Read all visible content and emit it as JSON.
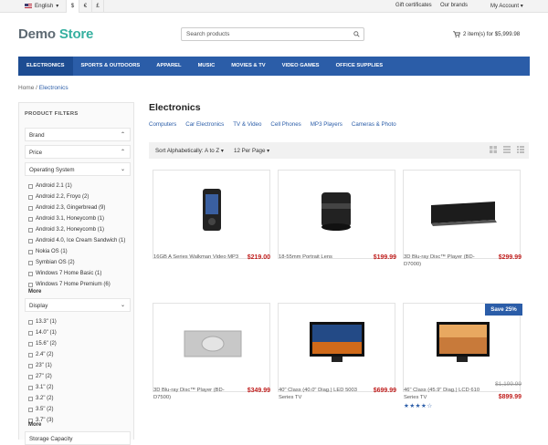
{
  "topbar": {
    "language": "English",
    "currencies": [
      "$",
      "€",
      "£"
    ],
    "links": [
      "Gift certificates",
      "Our brands"
    ],
    "account": "My Account"
  },
  "header": {
    "logo_part1": "Demo",
    "logo_part2": "Store",
    "search_placeholder": "Search products",
    "cart": "2 item(s) for $5,999.98"
  },
  "nav": [
    "ELECTRONICS",
    "SPORTS & OUTDOORS",
    "APPAREL",
    "MUSIC",
    "MOVIES & TV",
    "VIDEO GAMES",
    "OFFICE SUPPLIES"
  ],
  "breadcrumb": {
    "home": "Home",
    "sep": "/",
    "current": "Electronics"
  },
  "filters": {
    "heading": "PRODUCT FILTERS",
    "groups": [
      "Brand",
      "Price",
      "Operating System",
      "Display",
      "Storage Capacity"
    ],
    "os_options": [
      "Android 2.1 (1)",
      "Android 2.2, Froyo (2)",
      "Android 2.3, Gingerbread (9)",
      "Android 3.1, Honeycomb (1)",
      "Android 3.2, Honeycomb (1)",
      "Android 4.0, Ice Cream Sandwich (1)",
      "Nokia OS (1)",
      "Symbian OS (2)",
      "Windows 7 Home Basic (1)",
      "Windows 7 Home Premium (6)"
    ],
    "display_options": [
      "13.3\" (1)",
      "14.0\" (1)",
      "15.6\" (2)",
      "2.4\" (2)",
      "23\" (1)",
      "27\" (2)",
      "3.1\" (2)",
      "3.2\" (2)",
      "3.5\" (2)",
      "3.7\" (3)"
    ],
    "more": "More"
  },
  "main": {
    "title": "Electronics",
    "subcategories": [
      "Computers",
      "Car Electronics",
      "TV & Video",
      "Cell Phones",
      "MP3 Players",
      "Cameras & Photo"
    ],
    "sort": "Sort Alphabetically: A to Z",
    "per_page": "12 Per Page",
    "badge": "Save 25%",
    "rating_stars": 4,
    "products": [
      {
        "name": "16GB A Series Walkman Video MP3",
        "price": "$219.00"
      },
      {
        "name": "18-55mm Portrait Lens",
        "price": "$199.99"
      },
      {
        "name": "3D Blu-ray Disc™ Player (BD-D7000)",
        "price": "$299.99"
      },
      {
        "name": "3D Blu-ray Disc™ Player (BD-D7500)",
        "price": "$349.99"
      },
      {
        "name": "40\" Class (40.0\" Diag.) LED 5003 Series TV",
        "price": "$699.99"
      },
      {
        "name": "46\" Class (45.9\" Diag.) LCD 610 Series TV",
        "price": "$899.99",
        "old_price": "$1,199.99"
      }
    ]
  },
  "colors": {
    "brand_blue": "#2b5da8",
    "logo_teal": "#36b0a0",
    "price_red": "#c0201f"
  }
}
